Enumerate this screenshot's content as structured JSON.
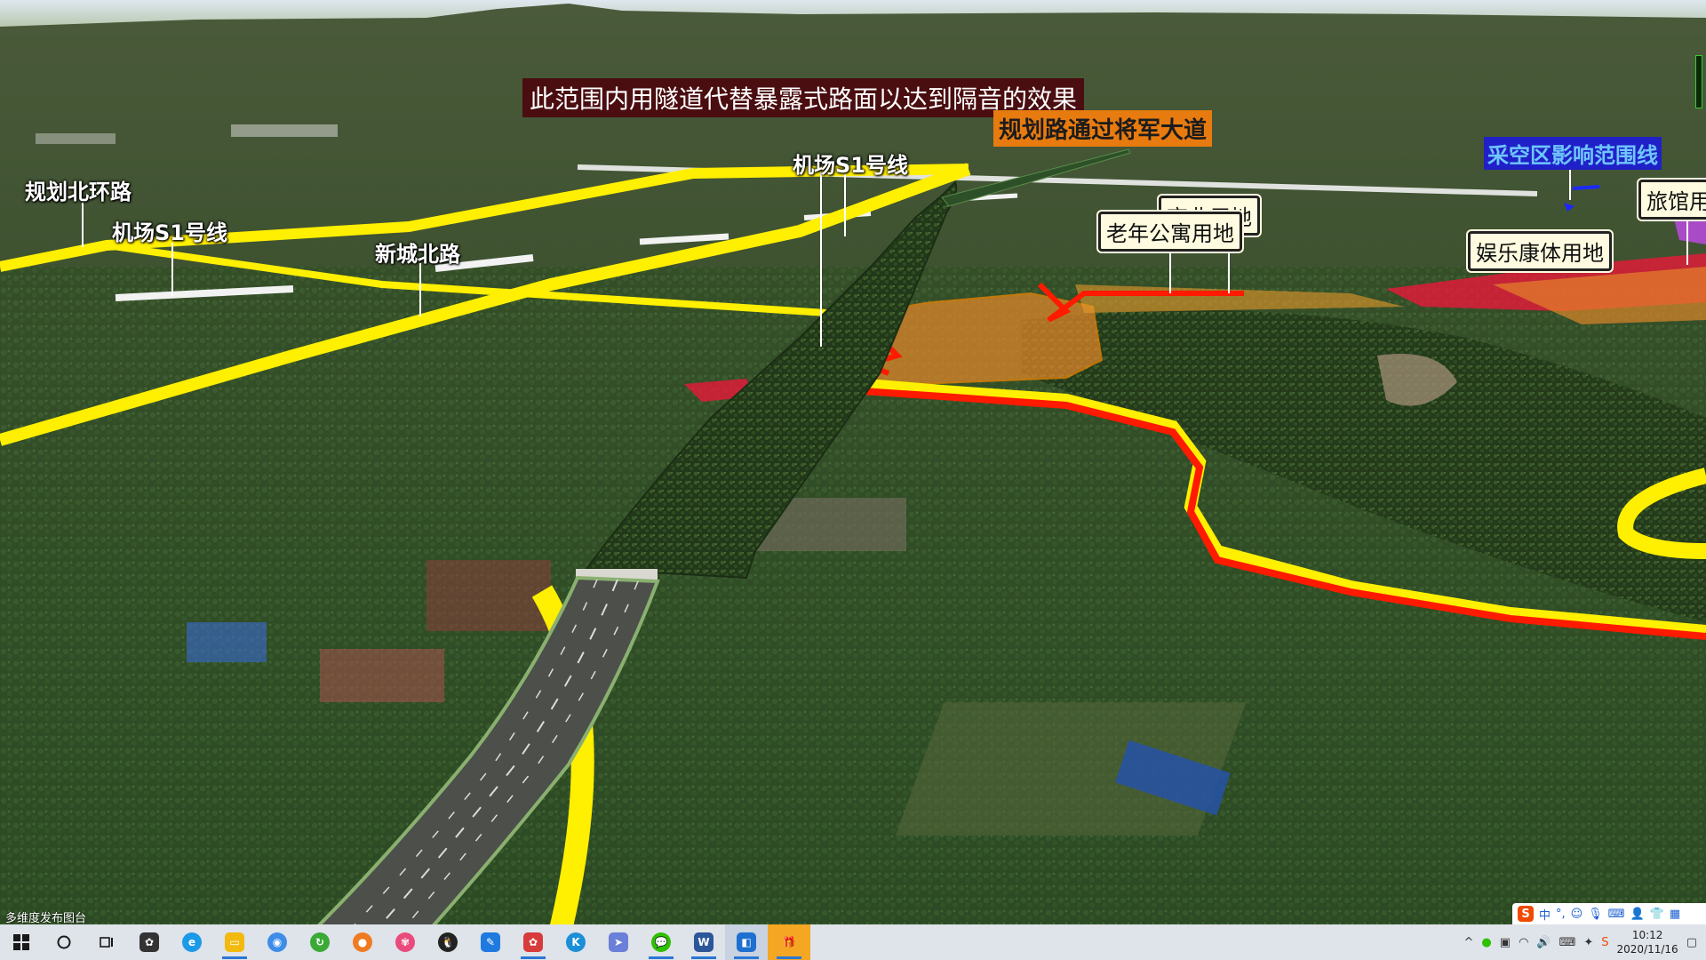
{
  "scene": {
    "main_banner": "此范围内用隧道代替暴露式路面以达到隔音的效果",
    "orange_banner": "规划路通过将军大道",
    "blue_banner": "采空区影响范围线",
    "road_labels": {
      "north_ring": "规划北环路",
      "s1_left": "机场S1号线",
      "xincheng": "新城北路",
      "s1_center": "机场S1号线"
    },
    "landuse_labels": {
      "commercial": "商业用地",
      "elderly": "老年公寓用地",
      "recreation": "娱乐康体用地",
      "hotel": "旅馆用"
    },
    "colors": {
      "road_yellow": "#ffef00",
      "boundary_red": "#ff1a00",
      "zone_orange": "#e8892a",
      "zone_red": "#e8193a",
      "zone_purple": "#b54ad6",
      "tunnel_green": "#24401c"
    }
  },
  "status_bar": {
    "text": "多维度发布图台"
  },
  "ime": {
    "logo": "S",
    "mode": "中"
  },
  "taskbar": {
    "icons": [
      {
        "name": "windows-start-icon",
        "glyph": "",
        "color": "#0078d7"
      },
      {
        "name": "search-circle-icon",
        "glyph": "",
        "color": "#dfe3ea"
      },
      {
        "name": "task-view-icon",
        "glyph": "",
        "color": "#dfe3ea"
      },
      {
        "name": "pinwheel-app-icon",
        "glyph": "",
        "color": "#333333"
      },
      {
        "name": "edge-browser-icon",
        "glyph": "",
        "color": "#1b9ae8"
      },
      {
        "name": "file-explorer-icon",
        "glyph": "",
        "color": "#f2b90f"
      },
      {
        "name": "blue-app-icon",
        "glyph": "",
        "color": "#3d8de8"
      },
      {
        "name": "green-refresh-app-icon",
        "glyph": "",
        "color": "#3aaa35"
      },
      {
        "name": "orange-app-icon",
        "glyph": "",
        "color": "#f07a20"
      },
      {
        "name": "flower-app-icon",
        "glyph": "",
        "color": "#e94b7c"
      },
      {
        "name": "qq-penguin-icon",
        "glyph": "",
        "color": "#222222"
      },
      {
        "name": "feishu-app-icon",
        "glyph": "",
        "color": "#1f7ae0"
      },
      {
        "name": "pinwheel-red-app-icon",
        "glyph": "",
        "color": "#d83b3b"
      },
      {
        "name": "k-app-icon",
        "glyph": "K",
        "color": "#1c8fd8"
      },
      {
        "name": "paper-plane-app-icon",
        "glyph": "",
        "color": "#6a7fd8"
      },
      {
        "name": "wechat-icon",
        "glyph": "",
        "color": "#2dc100"
      },
      {
        "name": "word-icon",
        "glyph": "W",
        "color": "#2b579a"
      },
      {
        "name": "map-app-icon",
        "glyph": "",
        "color": "#1e6fd0"
      },
      {
        "name": "gift-app-icon",
        "glyph": "",
        "color": "#f5a623"
      }
    ]
  },
  "tray": {
    "time": "10:12",
    "date": "2020/11/16"
  }
}
